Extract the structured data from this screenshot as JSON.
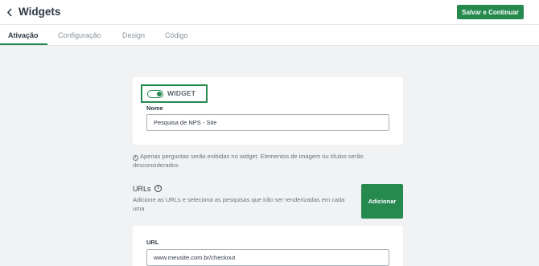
{
  "header": {
    "back_icon": "chevron-left-icon",
    "title": "Widgets",
    "save_label": "Salvar e Continuar",
    "accent_color": "#268a4f"
  },
  "tabs": [
    {
      "label": "Ativação",
      "active": true
    },
    {
      "label": "Configuração",
      "active": false
    },
    {
      "label": "Design",
      "active": false
    },
    {
      "label": "Código",
      "active": false
    }
  ],
  "widget_card": {
    "toggle_on": true,
    "toggle_label": "WIDGET",
    "name_label": "Nome",
    "name_value": "Pesquisa de NPS - Site"
  },
  "info_notice": {
    "icon": "info-icon",
    "text": "Apenas perguntas serão exibidas no widget. Elementos de imagem ou títulos serão desconsiderados"
  },
  "urls_section": {
    "title": "URLs",
    "info_icon": "info-icon",
    "description": "Adicione as URLs e seleciona as pesquisas que irão ser renderizadas em cada uma",
    "add_label": "Adicionar"
  },
  "url_card": {
    "url_label": "URL",
    "url_value": "www.meusite.com.br/checkout"
  }
}
